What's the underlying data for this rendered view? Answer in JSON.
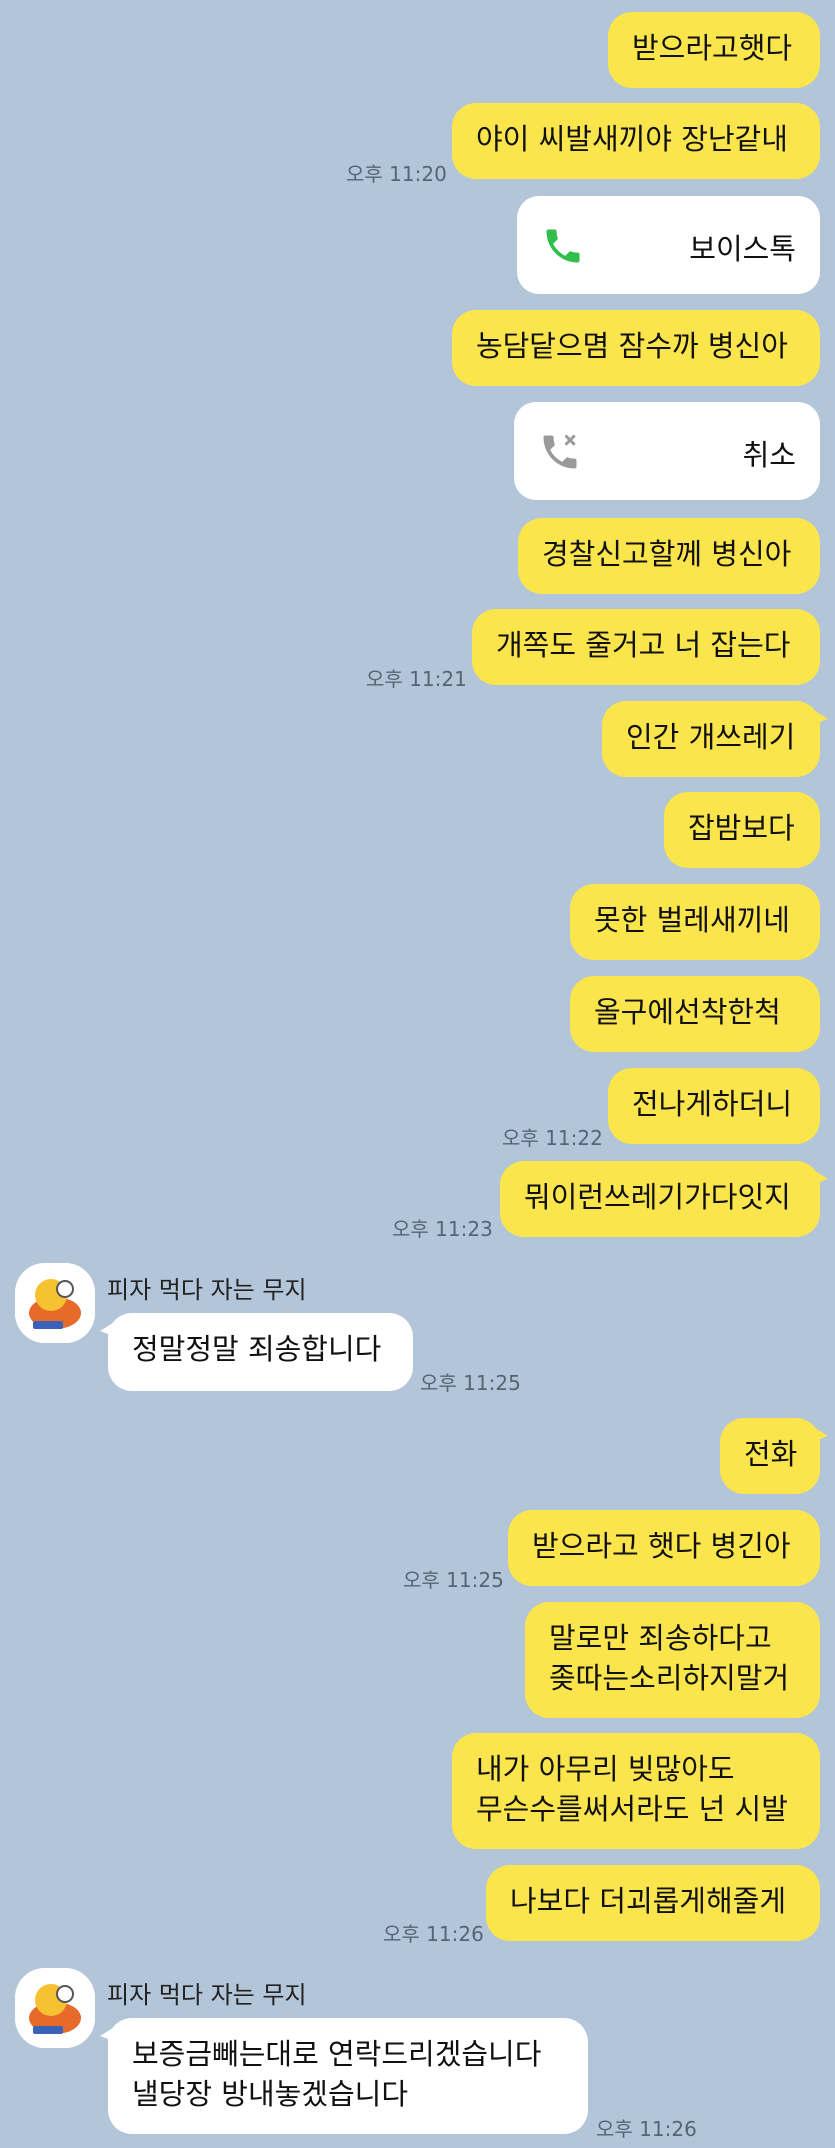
{
  "messages": {
    "m1": "받으라고햇다",
    "m2": "야이 씨발새끼야 장난같내",
    "m3": "농담닽으몀 잠수까 병신아",
    "m4": "경찰신고할께 병신아",
    "m5": "개쪽도 줄거고 너 잡는다",
    "m6": "인간 개쓰레기",
    "m7": "잡밤보다",
    "m8": "못한 벌레새끼네",
    "m9": "올구에선착한척",
    "m10": "전나게하더니",
    "m11": "뭐이런쓰레기가다잇지",
    "r1": "정말정말 죄송합니다",
    "m12": "전화",
    "m13": "받으라고 햇다 병긴아",
    "m14a": "말로만 죄송하다고",
    "m14b": "좆따는소리하지말거",
    "m15a": "내가 아무리 빚많아도",
    "m15b": "무슨수를써서라도 넌 시발",
    "m16": "나보다 더괴롭게해줄게",
    "r2a": "보증금빼는대로 연락드리겠습니다",
    "r2b": "낼당장 방내놓겠습니다"
  },
  "calls": {
    "voice_label": "보이스톡",
    "cancel_label": "취소",
    "voice_icon": "phone-icon",
    "cancel_icon": "missed-call-icon"
  },
  "contact": {
    "name": "피자 먹다 자는 무지"
  },
  "times": {
    "t1": "오후 11:20",
    "t2": "오후 11:21",
    "t3": "오후 11:22",
    "t4": "오후 11:23",
    "t5": "오후 11:25",
    "t6": "오후 11:25",
    "t7": "오후 11:26",
    "t8": "오후 11:26"
  },
  "colors": {
    "background": "#b3c5d8",
    "my_bubble": "#fbe54d",
    "their_bubble": "#ffffff",
    "call_green": "#2fbf4a"
  }
}
